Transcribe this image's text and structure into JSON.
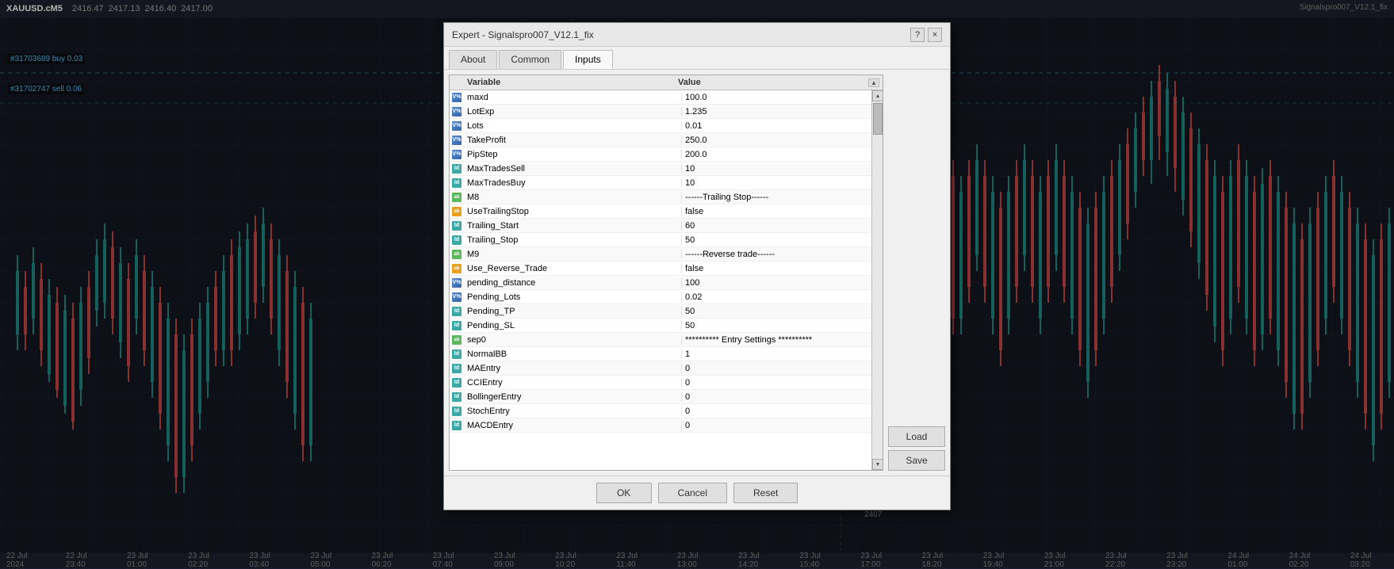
{
  "topbar": {
    "symbol": "XAUUSD.cM5",
    "prices": [
      "2416.47",
      "2417.13",
      "2416.40",
      "2417.00"
    ],
    "top_right": "Signalspro007_V12.1_fix"
  },
  "chart": {
    "trade1": "#31703689 buy 0.03",
    "trade2": "#31702747 sell 0.06"
  },
  "dialog": {
    "title": "Expert - Signalspro007_V12.1_fix",
    "help_label": "?",
    "close_label": "×",
    "tabs": [
      {
        "id": "about",
        "label": "About",
        "active": false
      },
      {
        "id": "common",
        "label": "Common",
        "active": false
      },
      {
        "id": "inputs",
        "label": "Inputs",
        "active": true
      }
    ],
    "table": {
      "col_variable": "Variable",
      "col_value": "Value",
      "rows": [
        {
          "icon": "blue",
          "name": "maxd",
          "value": "100.0"
        },
        {
          "icon": "blue",
          "name": "LotExp",
          "value": "1.235"
        },
        {
          "icon": "blue",
          "name": "Lots",
          "value": "0.01"
        },
        {
          "icon": "blue",
          "name": "TakeProfit",
          "value": "250.0"
        },
        {
          "icon": "blue",
          "name": "PipStep",
          "value": "200.0"
        },
        {
          "icon": "teal",
          "name": "MaxTradesSell",
          "value": "10"
        },
        {
          "icon": "teal",
          "name": "MaxTradesBuy",
          "value": "10"
        },
        {
          "icon": "green",
          "name": "M8",
          "value": "------Trailing Stop------"
        },
        {
          "icon": "orange",
          "name": "UseTrailingStop",
          "value": "false"
        },
        {
          "icon": "teal",
          "name": "Trailing_Start",
          "value": "60"
        },
        {
          "icon": "teal",
          "name": "Trailing_Stop",
          "value": "50"
        },
        {
          "icon": "green",
          "name": "M9",
          "value": "------Reverse trade------"
        },
        {
          "icon": "orange",
          "name": "Use_Reverse_Trade",
          "value": "false"
        },
        {
          "icon": "blue",
          "name": "pending_distance",
          "value": "100"
        },
        {
          "icon": "blue",
          "name": "Pending_Lots",
          "value": "0.02"
        },
        {
          "icon": "teal",
          "name": "Pending_TP",
          "value": "50"
        },
        {
          "icon": "teal",
          "name": "Pending_SL",
          "value": "50"
        },
        {
          "icon": "green",
          "name": "sep0",
          "value": "********** Entry Settings **********"
        },
        {
          "icon": "teal",
          "name": "NormalBB",
          "value": "1"
        },
        {
          "icon": "teal",
          "name": "MAEntry",
          "value": "0"
        },
        {
          "icon": "teal",
          "name": "CCIEntry",
          "value": "0"
        },
        {
          "icon": "teal",
          "name": "BollingerEntry",
          "value": "0"
        },
        {
          "icon": "teal",
          "name": "StochEntry",
          "value": "0"
        },
        {
          "icon": "teal",
          "name": "MACDEntry",
          "value": "0"
        }
      ]
    },
    "buttons": {
      "load": "Load",
      "save": "Save",
      "ok": "OK",
      "cancel": "Cancel",
      "reset": "Reset"
    }
  },
  "bottombar": {
    "dates": [
      "22 Jul 2024",
      "22 Jul 23:40",
      "23 Jul 01:00",
      "23 Jul 02:20",
      "23 Jul 03:40",
      "23 Jul 05:00",
      "23 Jul 06:20",
      "23 Jul 07:40",
      "23 Jul 09:00",
      "23 Jul 10:20",
      "23 Jul 11:40",
      "23 Jul 13:00",
      "23 Jul 14:20",
      "23 Jul 15:40",
      "23 Jul 17:00",
      "23 Jul 18:20",
      "23 Jul 19:40",
      "23 Jul 21:00",
      "23 Jul 22:20",
      "23 Jul 23:20",
      "24 Jul 01:00",
      "24 Jul 02:20",
      "24 Jul 03:20"
    ]
  }
}
